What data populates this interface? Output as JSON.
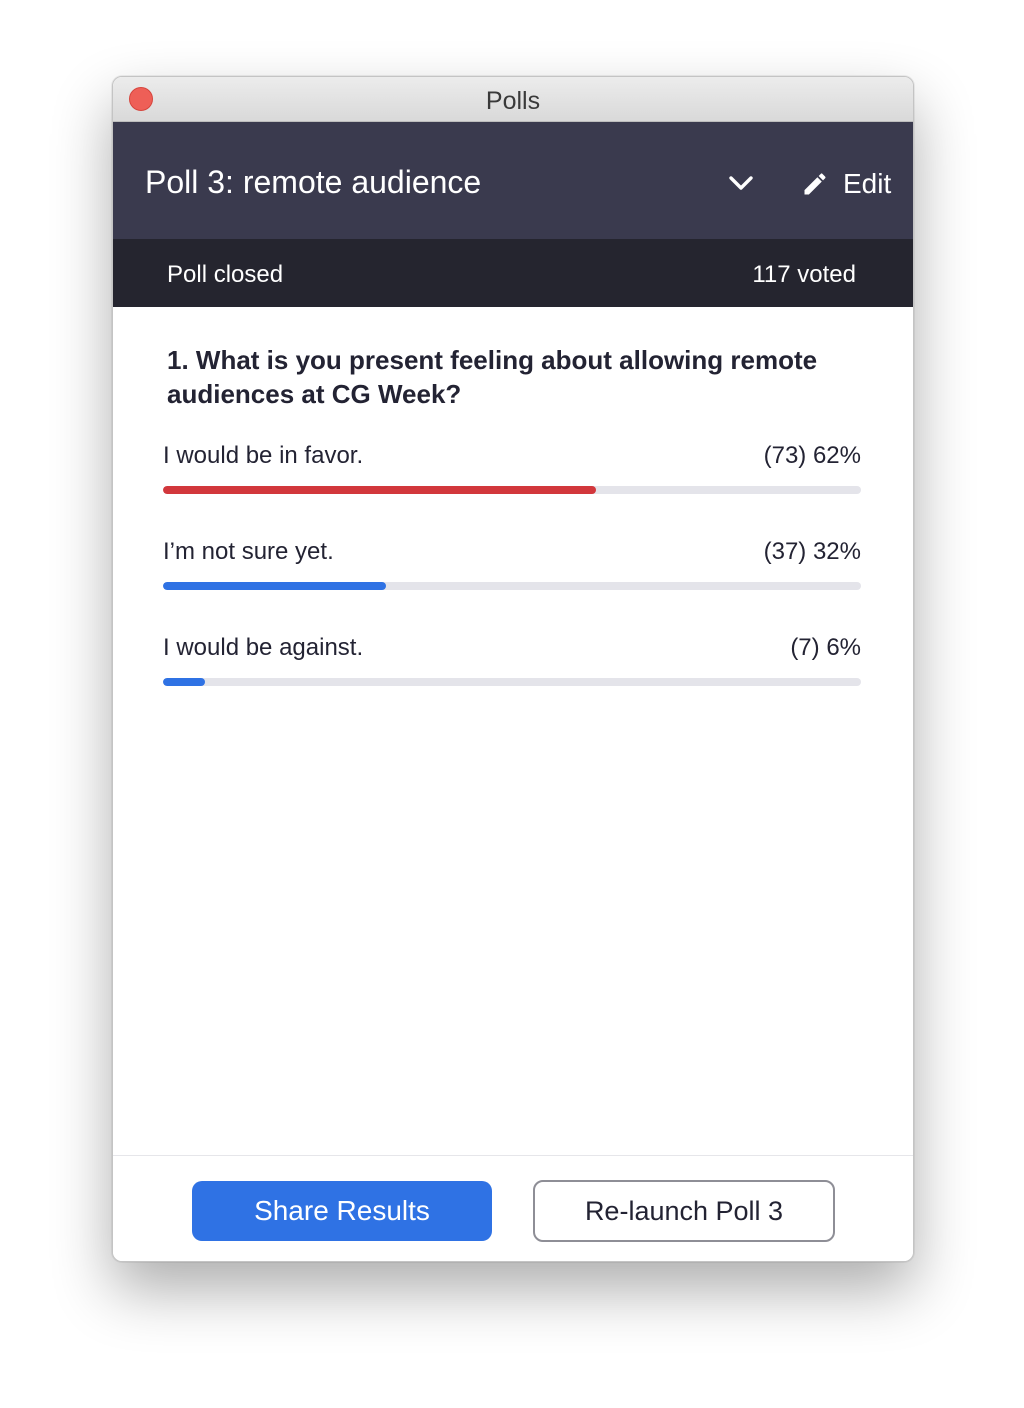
{
  "window": {
    "title": "Polls"
  },
  "header": {
    "poll_title": "Poll 3: remote audience",
    "chevron_icon": "chevron-down-icon",
    "edit_icon": "pencil-icon",
    "edit_label": "Edit"
  },
  "status": {
    "state": "Poll closed",
    "votes": "117 voted"
  },
  "question": {
    "text": "1. What is you present feeling about allowing remote audiences at CG Week?",
    "options": [
      {
        "label": "I would be in favor.",
        "result": "(73) 62%",
        "count": 73,
        "percent": 62,
        "color": "#d2373c"
      },
      {
        "label": "I’m not sure yet.",
        "result": "(37) 32%",
        "count": 37,
        "percent": 32,
        "color": "#2f72e4"
      },
      {
        "label": "I would be against.",
        "result": "(7) 6%",
        "count": 7,
        "percent": 6,
        "color": "#2f72e4"
      }
    ]
  },
  "footer": {
    "share_label": "Share Results",
    "relaunch_label": "Re-launch Poll 3"
  },
  "colors": {
    "header_bg": "#3a3a4e",
    "status_bg": "#25252f",
    "accent_blue": "#2f72e4",
    "accent_red": "#d2373c",
    "close_button": "#ee5f57"
  }
}
